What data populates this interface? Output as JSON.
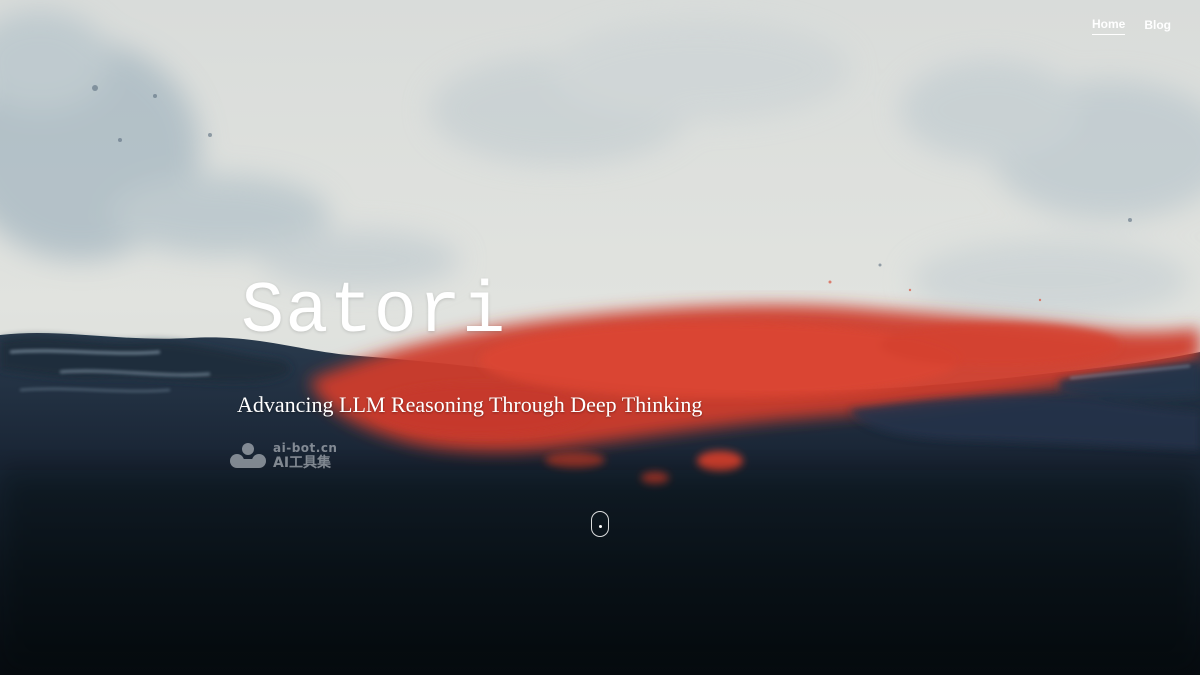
{
  "nav": {
    "items": [
      {
        "label": "Home",
        "active": true
      },
      {
        "label": "Blog",
        "active": false
      }
    ]
  },
  "hero": {
    "title": "Satori",
    "subtitle": "Advancing LLM Reasoning Through Deep Thinking",
    "background": "watercolor-sky-red-sea",
    "colors": {
      "sky": "#dcdfdd",
      "mist": "#a9bcc6",
      "red_band": "#d8412f",
      "sea": "#1b2838",
      "deep": "#080b10"
    }
  },
  "watermark": {
    "domain": "ai-bot.cn",
    "name": "AI工具集"
  },
  "scroll_indicator": {
    "icon": "mouse-scroll-icon"
  }
}
